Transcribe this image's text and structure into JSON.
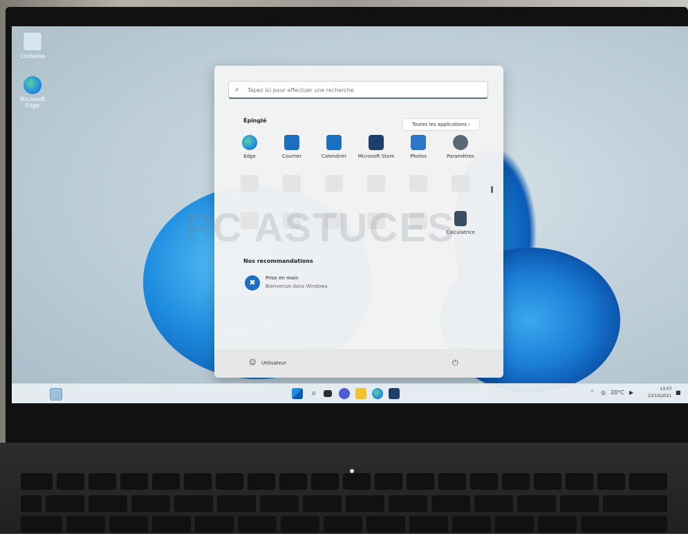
{
  "desktop": {
    "icons": [
      {
        "label": "Corbeille"
      },
      {
        "label": "Microsoft Edge"
      }
    ]
  },
  "start_menu": {
    "search": {
      "placeholder": "Tapez ici pour effectuer une recherche"
    },
    "pinned": {
      "title": "Épinglé",
      "all_apps_label": "Toutes les applications  ›",
      "apps": [
        {
          "label": "Edge",
          "icon": "edge-icon",
          "color": "#1f8ee0"
        },
        {
          "label": "Courrier",
          "icon": "mail-icon",
          "color": "#1b6ec2"
        },
        {
          "label": "Calendrier",
          "icon": "calendar-icon",
          "color": "#1b6ec2"
        },
        {
          "label": "Microsoft Store",
          "icon": "store-icon",
          "color": "#1e3f6e"
        },
        {
          "label": "Photos",
          "icon": "photos-icon",
          "color": "#2a76c8"
        },
        {
          "label": "Paramètres",
          "icon": "gear-icon",
          "color": "#5a6775"
        }
      ],
      "last_app": {
        "label": "Calculatrice",
        "icon": "calculator-icon",
        "color": "#3a4d63"
      }
    },
    "recommended": {
      "title": "Nos recommandations",
      "items": [
        {
          "title": "Prise en main",
          "subtitle": "Bienvenue dans Windows",
          "icon": "getstarted-icon"
        }
      ]
    },
    "footer": {
      "user": "Utilisateur",
      "power_icon": "power-icon"
    }
  },
  "watermark": {
    "text": "PC ASTUCES"
  },
  "taskbar": {
    "icons": [
      "start-icon",
      "search-icon",
      "taskview-icon",
      "chat-icon",
      "explorer-icon",
      "edge-icon",
      "store-icon"
    ],
    "tray": {
      "temp": "20°C"
    },
    "clock": {
      "time": "13:07",
      "date": "23/10/2021"
    }
  }
}
